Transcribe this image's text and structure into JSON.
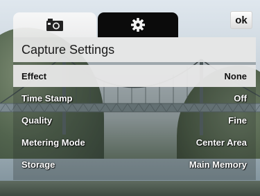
{
  "tabs": [
    {
      "name": "camera",
      "icon": "camera-icon",
      "active": true
    },
    {
      "name": "settings",
      "icon": "gear-icon",
      "active": false
    }
  ],
  "ok_label": "ok",
  "title": "Capture Settings",
  "settings": [
    {
      "label": "Effect",
      "value": "None",
      "selected": true
    },
    {
      "label": "Time Stamp",
      "value": "Off",
      "selected": false
    },
    {
      "label": "Quality",
      "value": "Fine",
      "selected": false
    },
    {
      "label": "Metering Mode",
      "value": "Center Area",
      "selected": false
    },
    {
      "label": "Storage",
      "value": "Main Memory",
      "selected": false
    }
  ],
  "colors": {
    "selected_row": "#e8e8e8",
    "settings_tab": "#0b0b0b"
  }
}
